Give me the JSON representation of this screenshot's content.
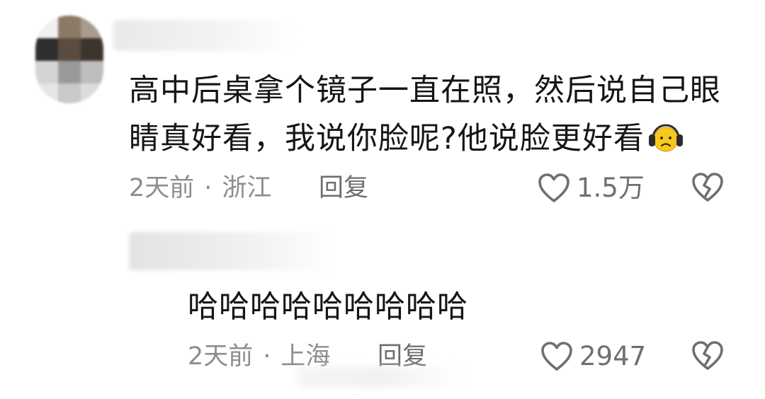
{
  "comments": [
    {
      "text": "高中后桌拿个镜子一直在照，然后说自己眼睛真好看，我说你脸呢?他说脸更好看",
      "emoji_icon": "sad-face-headphones-icon",
      "time": "2天前",
      "separator": "·",
      "location": "浙江",
      "reply_label": "回复",
      "like_count": "1.5万"
    }
  ],
  "replies": [
    {
      "text": "哈哈哈哈哈哈哈哈哈",
      "time": "2天前",
      "separator": "·",
      "location": "上海",
      "reply_label": "回复",
      "like_count": "2947"
    }
  ],
  "colors": {
    "text": "#151515",
    "meta": "#8d8d8d",
    "icon": "#6f6f6f",
    "emoji": "#f9c81e"
  }
}
